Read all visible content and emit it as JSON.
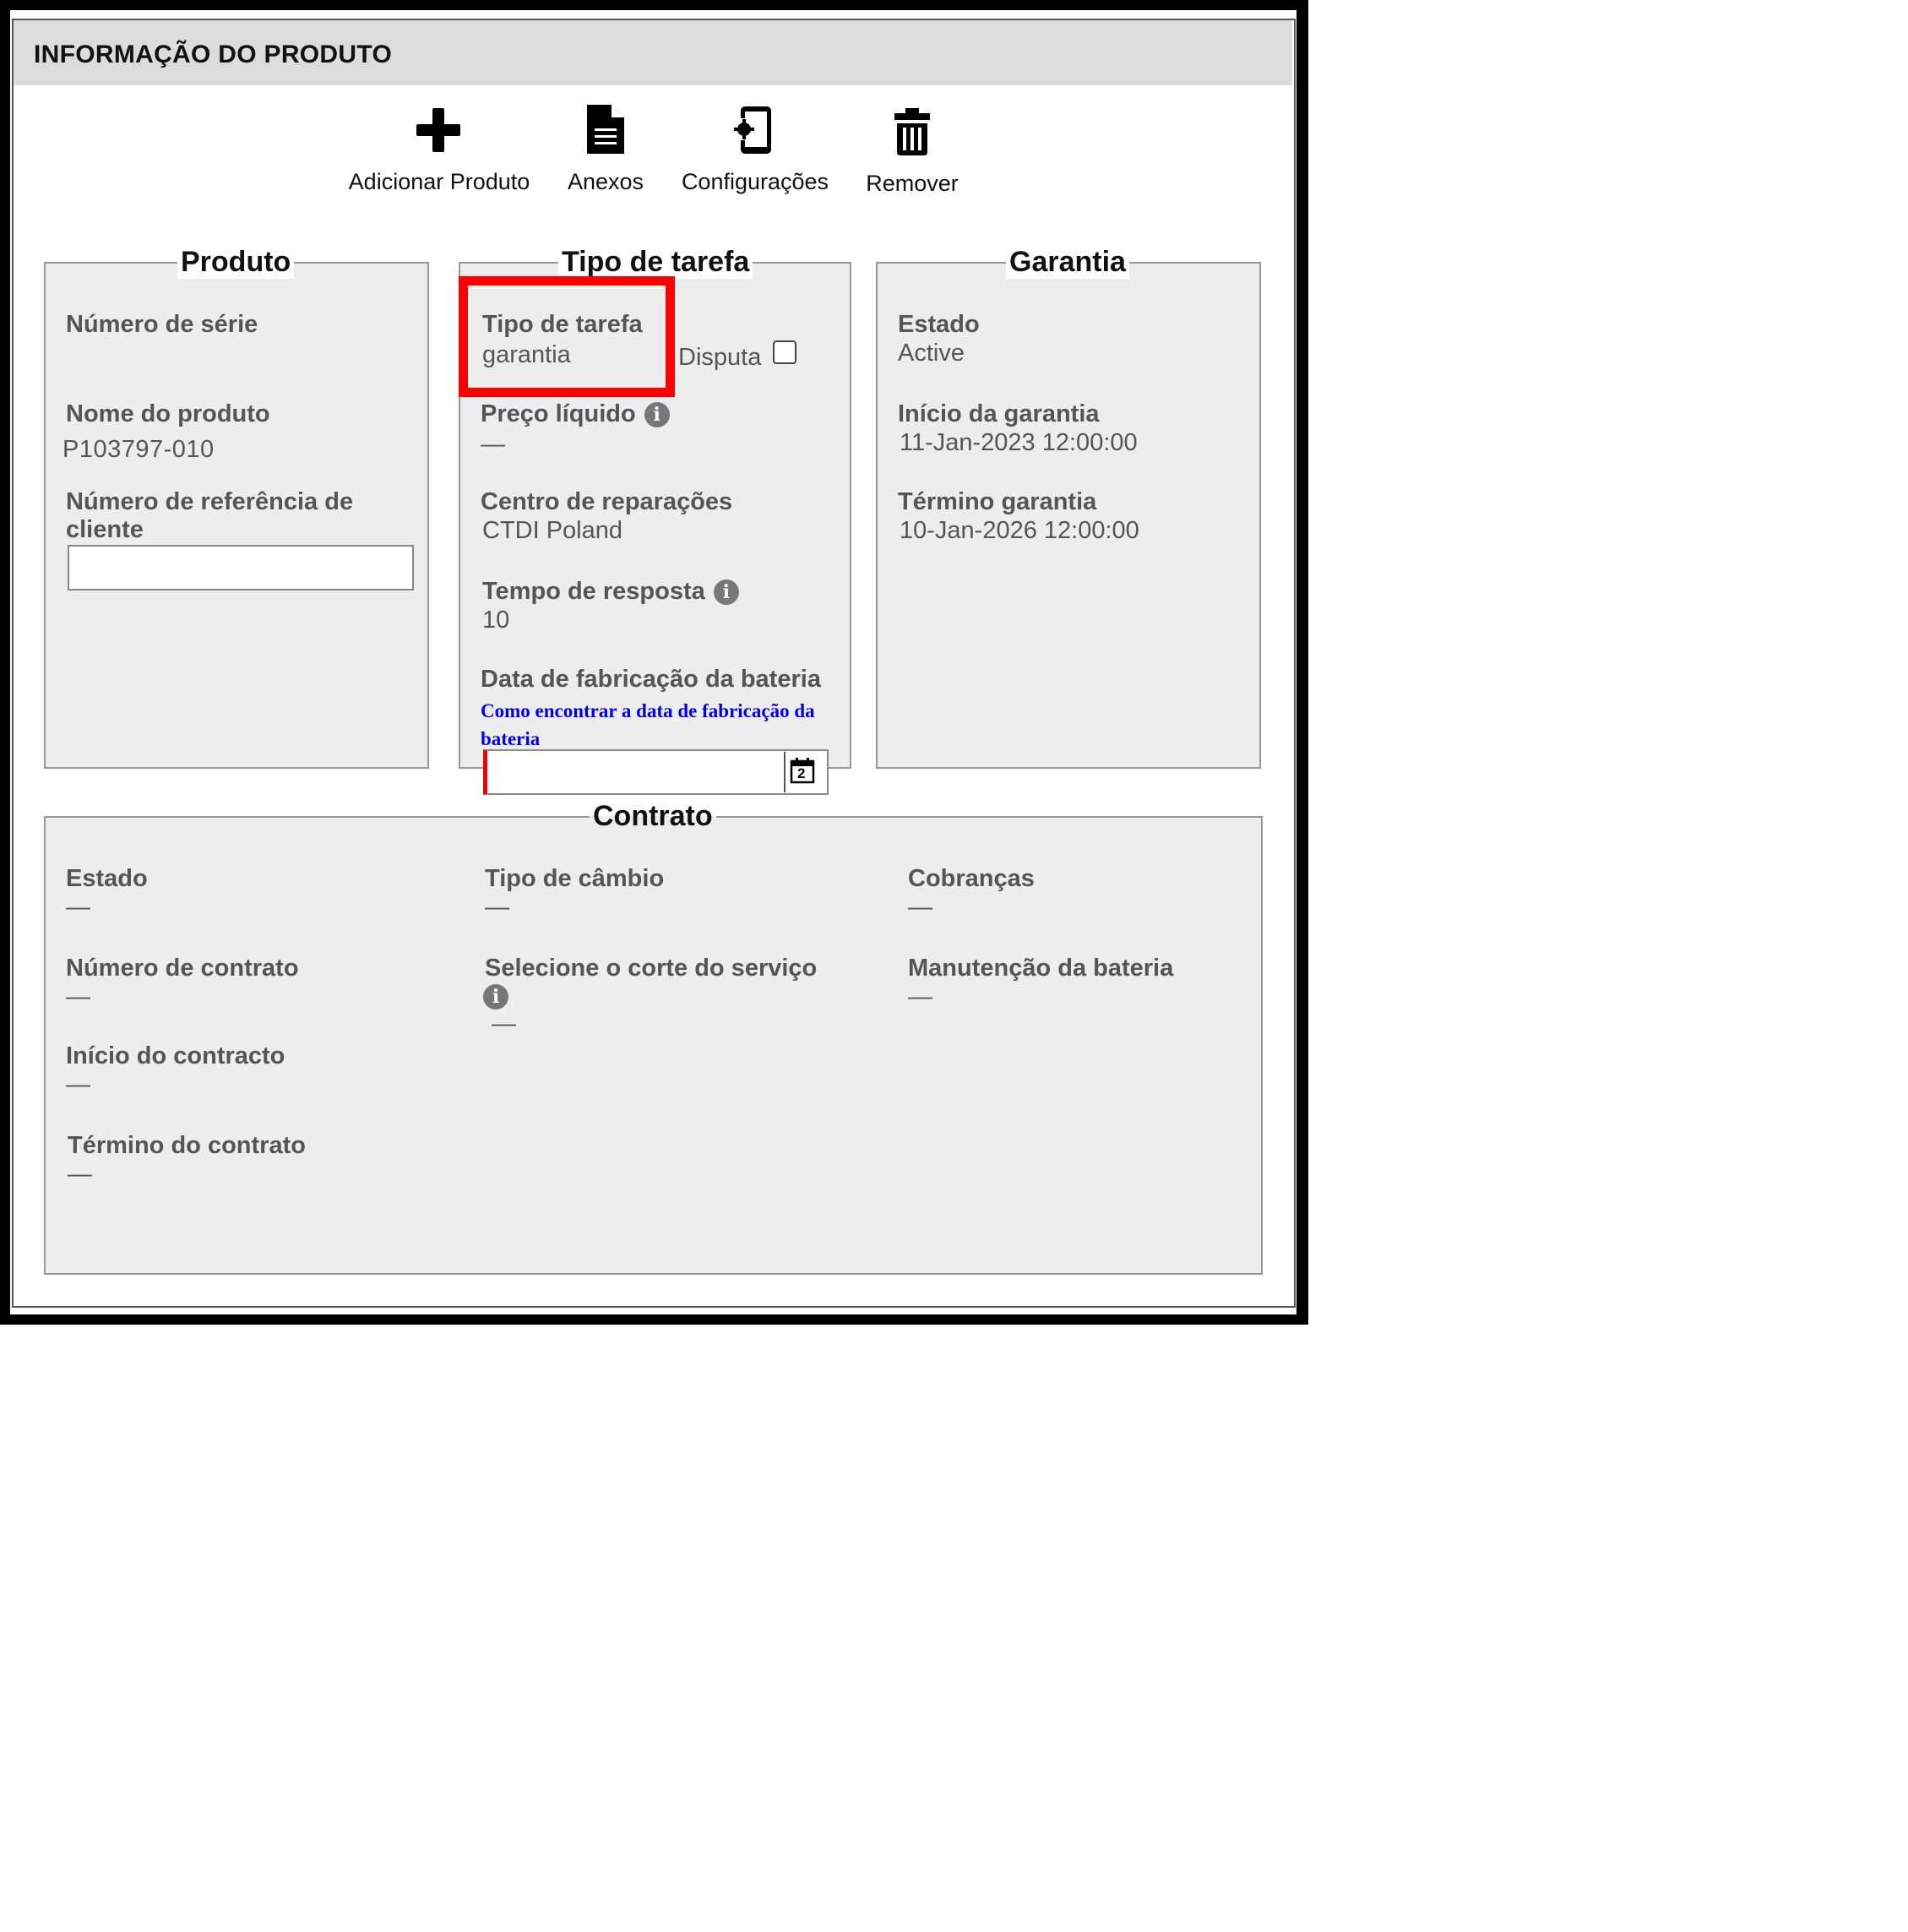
{
  "header": {
    "title": "INFORMAÇÃO DO PRODUTO"
  },
  "toolbar": {
    "add_label": "Adicionar Produto",
    "attachments_label": "Anexos",
    "settings_label": "Configurações",
    "remove_label": "Remover"
  },
  "produto": {
    "legend": "Produto",
    "serial_label": "Número de série",
    "name_label": "Nome do produto",
    "name_value": "P103797-010",
    "ref_label": "Número de referência de cliente",
    "ref_value": ""
  },
  "tarefa": {
    "legend": "Tipo de tarefa",
    "type_label": "Tipo de tarefa",
    "type_value": "garantia",
    "dispute_label": "Disputa",
    "dispute_checked": false,
    "price_label": "Preço líquido",
    "price_value": "—",
    "center_label": "Centro de reparações",
    "center_value": "CTDI Poland",
    "response_label": "Tempo de resposta",
    "response_value": "10",
    "battery_label": "Data de fabricação da bateria",
    "battery_link": "Como encontrar a data de fabricação da bateria",
    "battery_value": ""
  },
  "garantia": {
    "legend": "Garantia",
    "state_label": "Estado",
    "state_value": "Active",
    "start_label": "Início da garantia",
    "start_value": "11-Jan-2023 12:00:00",
    "end_label": "Término garantia",
    "end_value": "10-Jan-2026 12:00:00"
  },
  "contrato": {
    "legend": "Contrato",
    "state_label": "Estado",
    "state_value": "—",
    "number_label": "Número de contrato",
    "number_value": "—",
    "start_label": "Início do contracto",
    "start_value": "—",
    "end_label": "Término do contrato",
    "end_value": "—",
    "exchange_label": "Tipo de câmbio",
    "exchange_value": "—",
    "cutoff_label": "Selecione o corte do serviço",
    "cutoff_value": "—",
    "charges_label": "Cobranças",
    "charges_value": "—",
    "battery_label": "Manutenção da bateria",
    "battery_value": "—"
  },
  "calendar_day": "2",
  "colors": {
    "highlight": "#ff0000",
    "link": "#0000ee",
    "header_bg": "#dcdcdc",
    "panel_bg": "#ededed"
  }
}
